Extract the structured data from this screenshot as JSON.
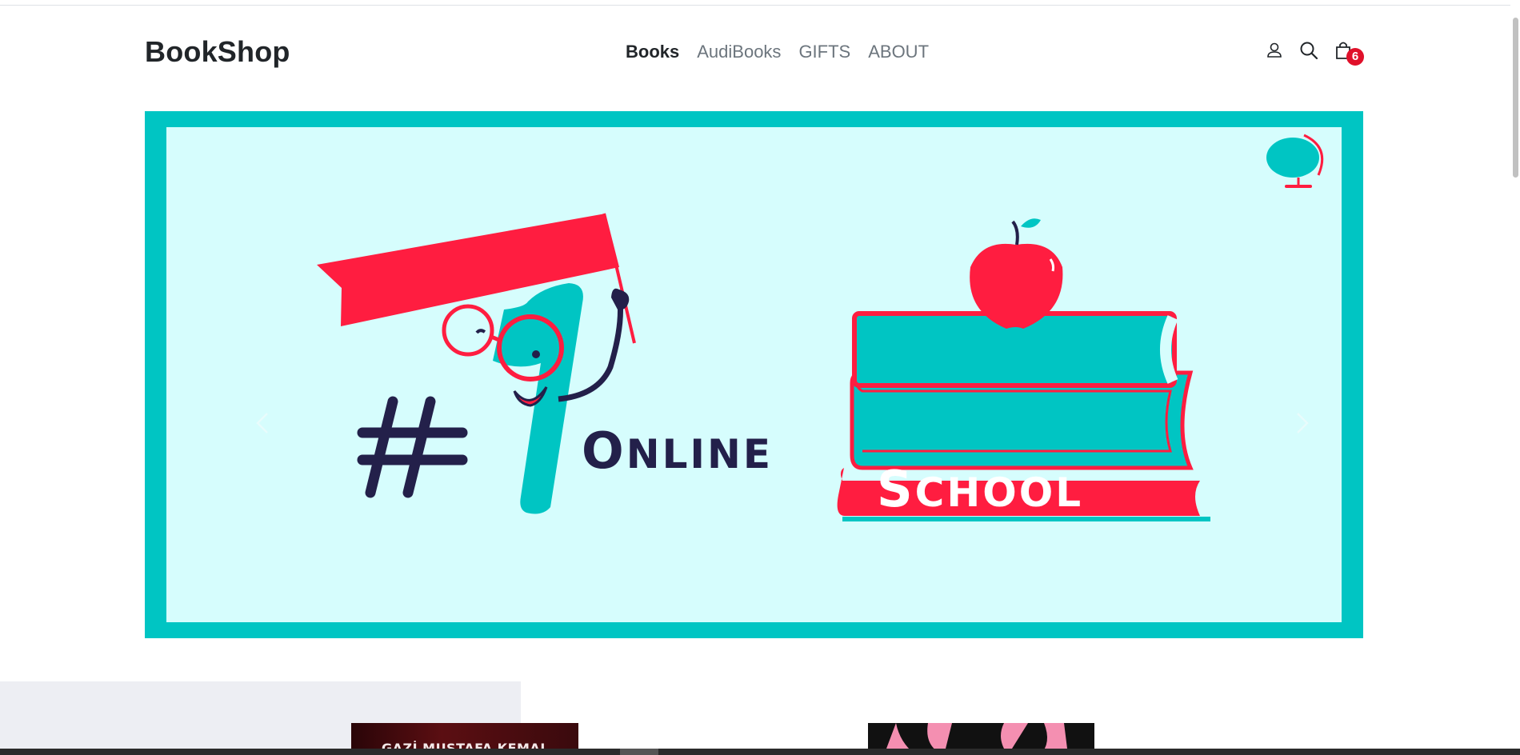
{
  "header": {
    "brand": "BookShop",
    "nav": [
      {
        "label": "Books",
        "active": true
      },
      {
        "label": "AudiBooks",
        "active": false
      },
      {
        "label": "GIFTS",
        "active": false
      },
      {
        "label": "ABOUT",
        "active": false
      }
    ],
    "icons": [
      "user-icon",
      "search-icon",
      "shopping-bag-icon"
    ],
    "cart_count": "6"
  },
  "carousel": {
    "slide": {
      "hashtag": "#",
      "number": "1",
      "word1": "Online",
      "word2": "School"
    },
    "controls": [
      "prev",
      "next"
    ],
    "colors": {
      "frame": "#00c5c3",
      "background": "#d6fdfd",
      "accent_red": "#ff1d40",
      "navy": "#23204a"
    }
  },
  "books_strip": {
    "first_book_title": "GAZİ MUSTAFA KEMAL"
  }
}
